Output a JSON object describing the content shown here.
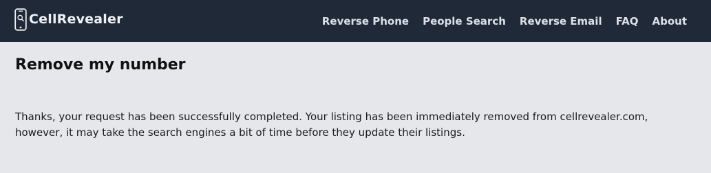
{
  "header": {
    "brand_name": "CellRevealer",
    "nav": [
      {
        "label": "Reverse Phone"
      },
      {
        "label": "People Search"
      },
      {
        "label": "Reverse Email"
      },
      {
        "label": "FAQ"
      },
      {
        "label": "About"
      }
    ]
  },
  "main": {
    "title": "Remove my number",
    "message": "Thanks, your request has been successfully completed. Your listing has been immediately removed from cellrevealer.com, however, it may take the search engines a bit of time before they update their listings."
  },
  "colors": {
    "header_bg": "#1f2937",
    "page_bg": "#e5e7eb",
    "nav_text": "#dde1e7"
  },
  "icons": {
    "logo": "phone-icon"
  }
}
